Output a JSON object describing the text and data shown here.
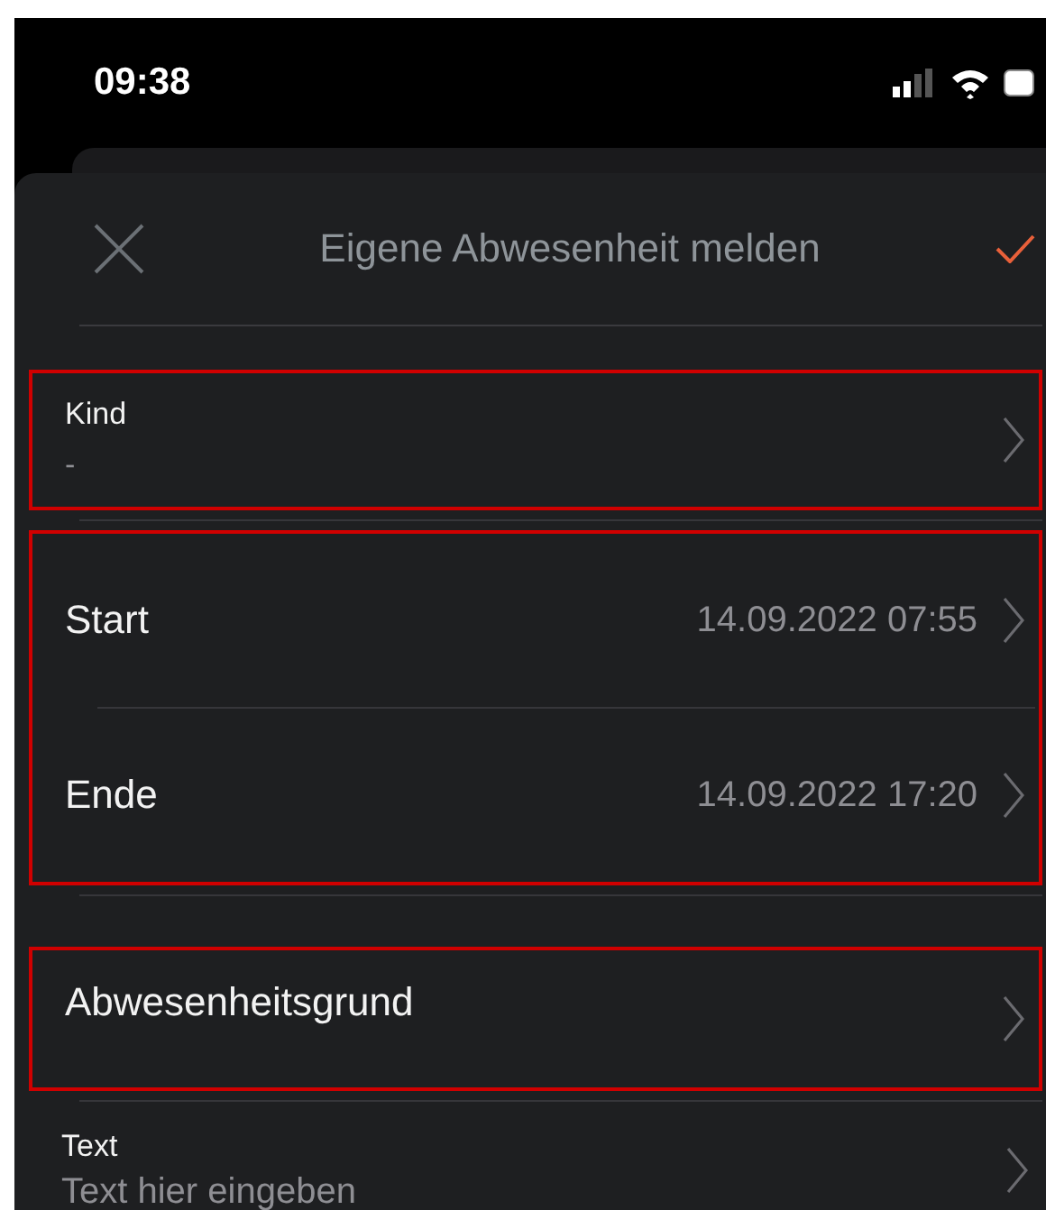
{
  "status_bar": {
    "time": "09:38"
  },
  "header": {
    "title": "Eigene Abwesenheit melden"
  },
  "groups": [
    {
      "highlighted": true,
      "fields": [
        {
          "kind": "stacked",
          "label": "Kind",
          "value": "-"
        }
      ]
    },
    {
      "highlighted": true,
      "fields": [
        {
          "kind": "inline",
          "label": "Start",
          "value": "14.09.2022 07:55"
        },
        {
          "kind": "inline",
          "label": "Ende",
          "value": "14.09.2022 17:20"
        }
      ]
    },
    {
      "highlighted": true,
      "fields": [
        {
          "kind": "single",
          "label": "Abwesenheitsgrund"
        }
      ]
    },
    {
      "highlighted": false,
      "fields": [
        {
          "kind": "input",
          "label": "Text",
          "placeholder": "Text hier eingeben"
        }
      ]
    }
  ]
}
